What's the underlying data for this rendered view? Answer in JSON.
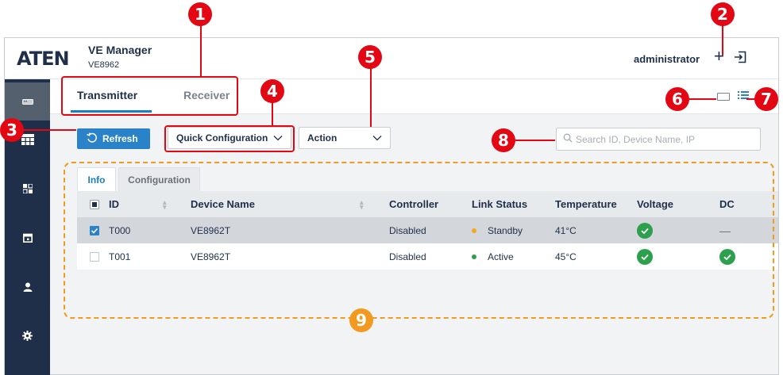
{
  "header": {
    "logo": "ATEN",
    "app_title": "VE Manager",
    "app_model": "VE8962",
    "user_name": "administrator",
    "add_icon": "plus-icon",
    "logout_icon": "logout-icon"
  },
  "sidebar": {
    "items": [
      {
        "icon": "device-icon",
        "active": true
      },
      {
        "icon": "grid-icon",
        "active": false
      },
      {
        "icon": "layout-icon",
        "active": false
      },
      {
        "icon": "calendar-icon",
        "active": false
      },
      {
        "icon": "user-icon",
        "active": false
      },
      {
        "icon": "gear-icon",
        "active": false
      }
    ]
  },
  "tabs": {
    "transmitter": "Transmitter",
    "receiver": "Receiver",
    "active": "Transmitter"
  },
  "toolbar": {
    "refresh_label": "Refresh",
    "quick_config_label": "Quick Configuration",
    "action_label": "Action",
    "search_placeholder": "Search ID, Device Name, IP"
  },
  "inner_tabs": {
    "info": "Info",
    "configuration": "Configuration",
    "active": "Info"
  },
  "table": {
    "columns": [
      "ID",
      "Device Name",
      "Controller",
      "Link Status",
      "Temperature",
      "Voltage",
      "DC"
    ],
    "rows": [
      {
        "id": "T000",
        "device_name": "VE8962T",
        "controller": "Disabled",
        "link_status": "Standby",
        "link_color": "#f5a623",
        "temperature": "41°C",
        "voltage": "ok",
        "dc": "—",
        "selected": true
      },
      {
        "id": "T001",
        "device_name": "VE8962T",
        "controller": "Disabled",
        "link_status": "Active",
        "link_color": "#2e9f4c",
        "temperature": "45°C",
        "voltage": "ok",
        "dc": "ok",
        "selected": false
      }
    ]
  },
  "callouts": [
    "1",
    "2",
    "3",
    "4",
    "5",
    "6",
    "7",
    "8",
    "9"
  ],
  "colors": {
    "accent": "#2a83c9",
    "sidebar": "#1f2f4a",
    "callout_red": "#e30613",
    "callout_orange": "#f29a1f",
    "ok_green": "#2e9f4c"
  }
}
